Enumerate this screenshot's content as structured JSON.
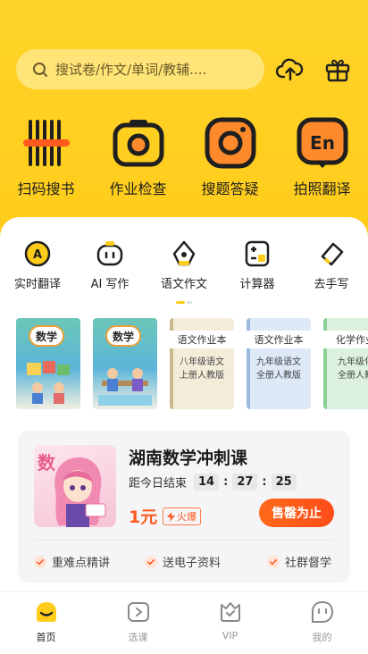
{
  "search": {
    "placeholder": "搜试卷/作文/单词/教辅...."
  },
  "header_icons": {
    "upload": "cloud-upload-icon",
    "gift": "gift-icon"
  },
  "big_actions": [
    {
      "label": "扫码搜书",
      "icon": "barcode-icon"
    },
    {
      "label": "作业检查",
      "icon": "camera-icon"
    },
    {
      "label": "搜题答疑",
      "icon": "instagram-camera-icon"
    },
    {
      "label": "拍照翻译",
      "icon": "en-translate-icon"
    }
  ],
  "tools": [
    {
      "label": "实时翻译",
      "icon": "realtime-translate-icon"
    },
    {
      "label": "AI 写作",
      "icon": "ai-robot-icon"
    },
    {
      "label": "语文作文",
      "icon": "pen-nib-icon"
    },
    {
      "label": "计算器",
      "icon": "calculator-icon"
    },
    {
      "label": "去手写",
      "icon": "eraser-icon"
    }
  ],
  "books": [
    {
      "type": "math",
      "badge": "数学"
    },
    {
      "type": "math",
      "badge": "数学"
    },
    {
      "type": "yw",
      "head": "语文作业本",
      "sub1": "八年级语文",
      "sub2": "上册人教版"
    },
    {
      "type": "yw2",
      "head": "语文作业本",
      "sub1": "九年级语文",
      "sub2": "全册人教版"
    },
    {
      "type": "hx",
      "head": "化学作业",
      "sub1": "九年级化",
      "sub2": "全册人教"
    }
  ],
  "course": {
    "cover_char": "数",
    "title": "湖南数学冲刺课",
    "countdown_label": "距今日结束",
    "hours": "14",
    "minutes": "27",
    "seconds": "25",
    "sep": ":",
    "price": "1元",
    "hot_label": "火爆",
    "buy_label": "售罄为止",
    "features": [
      "重难点精讲",
      "送电子资料",
      "社群督学"
    ]
  },
  "tabbar": [
    {
      "label": "首页",
      "icon": "home-icon",
      "active": true
    },
    {
      "label": "选课",
      "icon": "play-course-icon",
      "active": false
    },
    {
      "label": "VIP",
      "icon": "vip-icon",
      "active": false
    },
    {
      "label": "我的",
      "icon": "profile-face-icon",
      "active": false
    }
  ],
  "colors": {
    "brand_yellow": "#ffcc1a",
    "accent_orange": "#ff5a1f"
  }
}
